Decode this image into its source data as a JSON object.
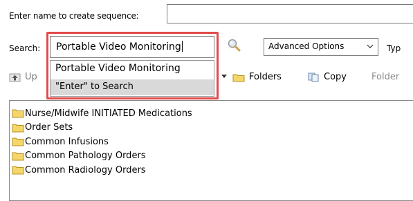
{
  "sequence": {
    "label": "Enter name to create sequence:",
    "value": ""
  },
  "search": {
    "label": "Search:",
    "value": "Portable Video Monitoring",
    "icon": "search-icon"
  },
  "advanced": {
    "selected": "Advanced Options",
    "type_label": "Typ"
  },
  "toolbar": {
    "up_label": "Up",
    "folders_label": "Folders",
    "copy_label": "Copy",
    "folder_label": "Folder"
  },
  "autocomplete": {
    "items": [
      "Portable Video Monitoring",
      "\"Enter\" to Search"
    ]
  },
  "tree": {
    "items": [
      "Nurse/Midwife INITIATED Medications",
      "Order Sets",
      "Common Infusions",
      "Common Pathology Orders",
      "Common Radiology Orders"
    ]
  },
  "colors": {
    "highlight": "#e34a4a",
    "folder_fill": "#f5d66b",
    "folder_stroke": "#b8901f",
    "selected_row": "#d9d9d9"
  }
}
